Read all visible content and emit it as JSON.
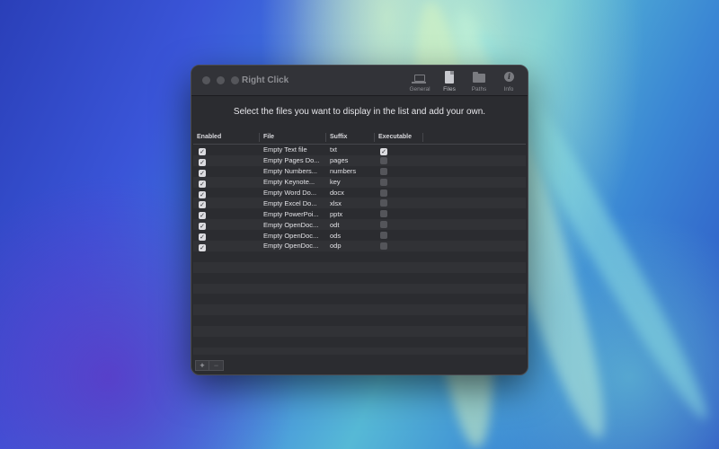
{
  "window": {
    "title": "Right Click",
    "toolbar": [
      {
        "label": "General",
        "icon": "laptop-icon",
        "active": false
      },
      {
        "label": "Files",
        "icon": "file-icon",
        "active": true
      },
      {
        "label": "Paths",
        "icon": "folder-icon",
        "active": false
      },
      {
        "label": "Info",
        "icon": "info-icon",
        "active": false
      }
    ],
    "info_glyph": "i"
  },
  "instruction": "Select the files you want to display in the list and add your own.",
  "table": {
    "headers": {
      "enabled": "Enabled",
      "file": "File",
      "suffix": "Suffix",
      "executable": "Executable"
    },
    "rows": [
      {
        "enabled": true,
        "file": "Empty Text file",
        "suffix": "txt",
        "executable": true
      },
      {
        "enabled": true,
        "file": "Empty Pages Do...",
        "suffix": "pages",
        "executable": false
      },
      {
        "enabled": true,
        "file": "Empty Numbers...",
        "suffix": "numbers",
        "executable": false
      },
      {
        "enabled": true,
        "file": "Empty Keynote...",
        "suffix": "key",
        "executable": false
      },
      {
        "enabled": true,
        "file": "Empty Word Do...",
        "suffix": "docx",
        "executable": false
      },
      {
        "enabled": true,
        "file": "Empty Excel Do...",
        "suffix": "xlsx",
        "executable": false
      },
      {
        "enabled": true,
        "file": "Empty PowerPoi...",
        "suffix": "pptx",
        "executable": false
      },
      {
        "enabled": true,
        "file": "Empty OpenDoc...",
        "suffix": "odt",
        "executable": false
      },
      {
        "enabled": true,
        "file": "Empty OpenDoc...",
        "suffix": "ods",
        "executable": false
      },
      {
        "enabled": true,
        "file": "Empty OpenDoc...",
        "suffix": "odp",
        "executable": false
      }
    ],
    "empty_rows": 10
  },
  "buttons": {
    "add": "+",
    "remove": "−"
  },
  "check_glyph": "✓"
}
